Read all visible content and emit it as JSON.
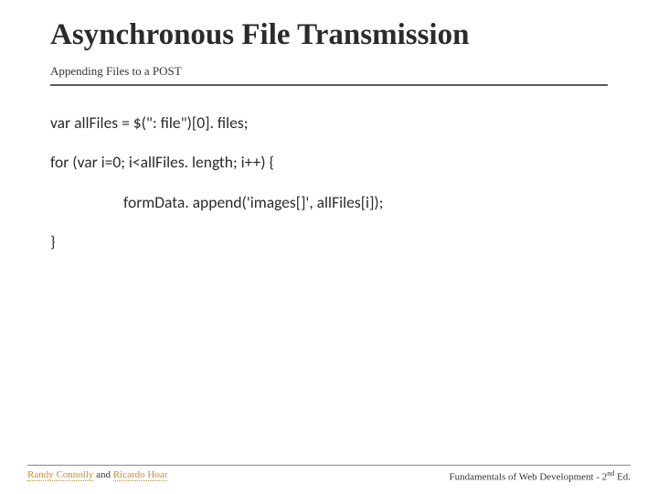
{
  "title": "Asynchronous File Transmission",
  "subtitle": "Appending Files to a POST",
  "code": {
    "line1": "var allFiles = $(\": file\")[0]. files;",
    "line2": "for (var i=0; i<allFiles. length; i++) {",
    "line3": "formData. append('images[]', allFiles[i]);",
    "line4": "}"
  },
  "footer": {
    "author1": "Randy Connolly",
    "joiner": " and ",
    "author2": "Ricardo Hoar",
    "book_prefix": "Fundamentals of Web Development - 2",
    "book_super": "nd",
    "book_suffix": " Ed."
  }
}
